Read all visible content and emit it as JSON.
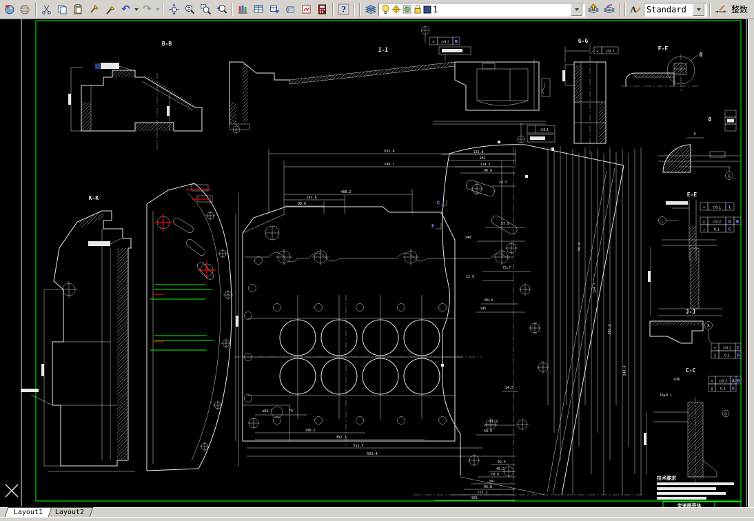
{
  "toolbar": {
    "layer_combo": {
      "value": "1"
    },
    "text_style_combo": {
      "value": "Standard"
    },
    "dim_style_label": "整数",
    "icons": {
      "help": "?",
      "text_style": "A",
      "undo": "↶",
      "redo": "↷"
    }
  },
  "tabs": {
    "items": [
      {
        "label": "Layout1",
        "active": true
      },
      {
        "label": "Layout2",
        "active": false
      }
    ]
  },
  "drawing": {
    "colors": {
      "frame": "#00ff00",
      "lines": "#e8e8e8",
      "highlight": "#ff0000",
      "datum_ref": "#7d90ff"
    },
    "view_labels": {
      "bb": "B-B",
      "ii": "I-I",
      "gg": "G-G",
      "ff": "F-F",
      "kk": "K-K",
      "ee": "E-E",
      "jj": "J-J",
      "cc": "C-C"
    },
    "detail_label": "O",
    "datum_circles": {
      "a": "A",
      "b": "B",
      "c": "C",
      "d": "D",
      "e": "E",
      "g": "G",
      "l": "L"
    },
    "notes_title": "技术要求",
    "title_block_text": "变速器壳体",
    "dims": {
      "top": [
        "655.8",
        "590.7",
        "408.2",
        "191.8",
        "98.6"
      ],
      "right_top": [
        "123.8",
        "182",
        "114.5",
        "96.6"
      ],
      "right_mid": [
        "24.5",
        "57.9",
        "140",
        "73.7",
        "12.9",
        "84.9",
        "145",
        "14.5",
        "41.9",
        "59.4"
      ],
      "right_rot": [
        "96.4",
        "124.7",
        "202.2",
        "249.4"
      ],
      "bottom_chain": [
        "42.5",
        "45.5",
        "70.9",
        "84",
        "96.8",
        "122.2",
        "156"
      ],
      "bottom_center": [
        "∅62.7",
        "74",
        "190.5",
        "392.7",
        "511.5",
        "591.4"
      ],
      "detail": "9",
      "cc": [
        "∅36",
        "16±0.1"
      ],
      "gdt_values": [
        "∅0.1",
        "∅0.2",
        "0.1",
        "∅0.7"
      ]
    },
    "gdt_symbols": {
      "position": "⌖",
      "parallel": "∥",
      "perp": "⊥"
    }
  }
}
